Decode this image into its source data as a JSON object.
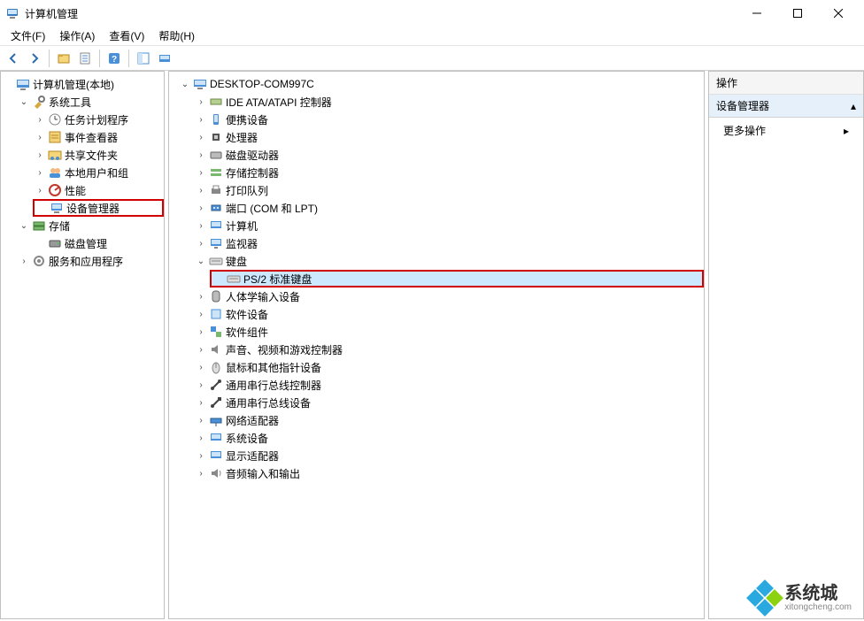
{
  "titlebar": {
    "title": "计算机管理"
  },
  "menubar": {
    "file": "文件(F)",
    "action": "操作(A)",
    "view": "查看(V)",
    "help": "帮助(H)"
  },
  "left_tree": {
    "root": "计算机管理(本地)",
    "tools": "系统工具",
    "task": "任务计划程序",
    "event": "事件查看器",
    "shared": "共享文件夹",
    "users": "本地用户和组",
    "perf": "性能",
    "devmgr": "设备管理器",
    "storage": "存储",
    "diskmgmt": "磁盘管理",
    "services": "服务和应用程序"
  },
  "device_tree": {
    "host": "DESKTOP-COM997C",
    "ide": "IDE ATA/ATAPI 控制器",
    "portable": "便携设备",
    "cpu": "处理器",
    "drive": "磁盘驱动器",
    "storage_ctrl": "存储控制器",
    "printq": "打印队列",
    "ports": "端口 (COM 和 LPT)",
    "computer": "计算机",
    "monitor": "监视器",
    "keyboard": "键盘",
    "ps2kb": "PS/2 标准键盘",
    "hid": "人体学输入设备",
    "swdev": "软件设备",
    "swcomp": "软件组件",
    "sound": "声音、视频和游戏控制器",
    "mouse": "鼠标和其他指针设备",
    "usb_ctrl": "通用串行总线控制器",
    "usb_dev": "通用串行总线设备",
    "net": "网络适配器",
    "sysdev": "系统设备",
    "display": "显示适配器",
    "audio_io": "音频输入和输出"
  },
  "actions": {
    "header": "操作",
    "section": "设备管理器",
    "more": "更多操作"
  },
  "watermark": {
    "cn": "系统城",
    "en": "xitongcheng.com"
  }
}
